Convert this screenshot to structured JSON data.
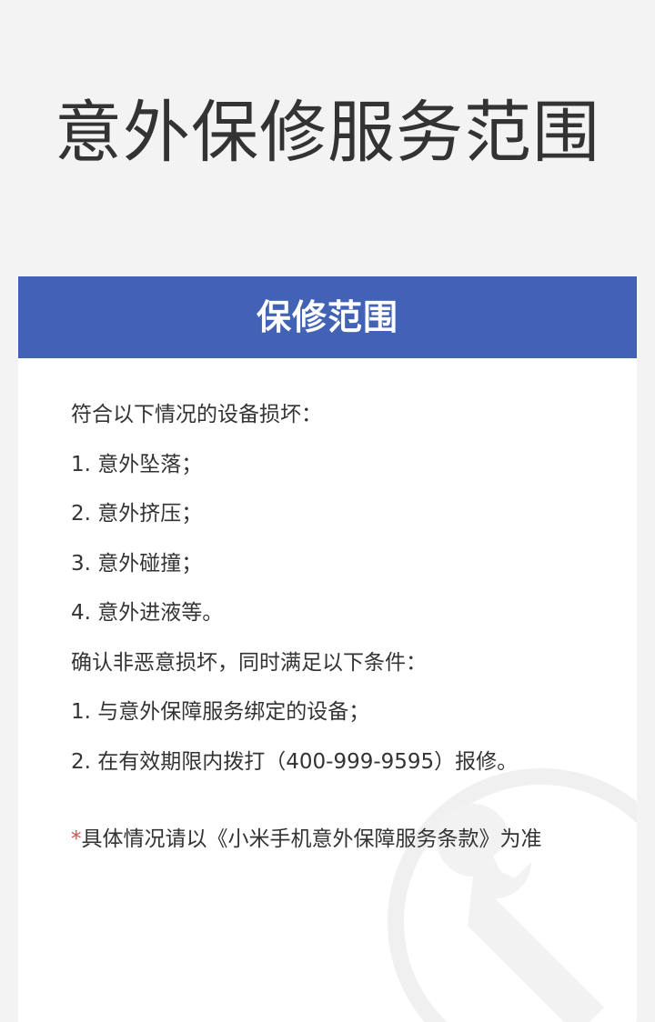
{
  "page": {
    "title": "意外保修服务范围"
  },
  "card": {
    "header": "保修范围",
    "intro": "符合以下情况的设备损坏：",
    "damage_items": [
      "1. 意外坠落；",
      "2. 意外挤压；",
      "3. 意外碰撞；",
      "4. 意外进液等。"
    ],
    "condition_intro": "确认非恶意损坏，同时满足以下条件：",
    "conditions": [
      "1. 与意外保障服务绑定的设备；",
      "2. 在有效期限内拨打（400-999-9595）报修。"
    ],
    "note_mark": "*",
    "note": "具体情况请以《小米手机意外保障服务条款》为准"
  },
  "colors": {
    "header_bg": "#4262b6",
    "page_bg": "#f3f3f3",
    "note_mark": "#e04b4b",
    "text": "#333333"
  },
  "icons": {
    "watermark": "wrench-icon"
  }
}
